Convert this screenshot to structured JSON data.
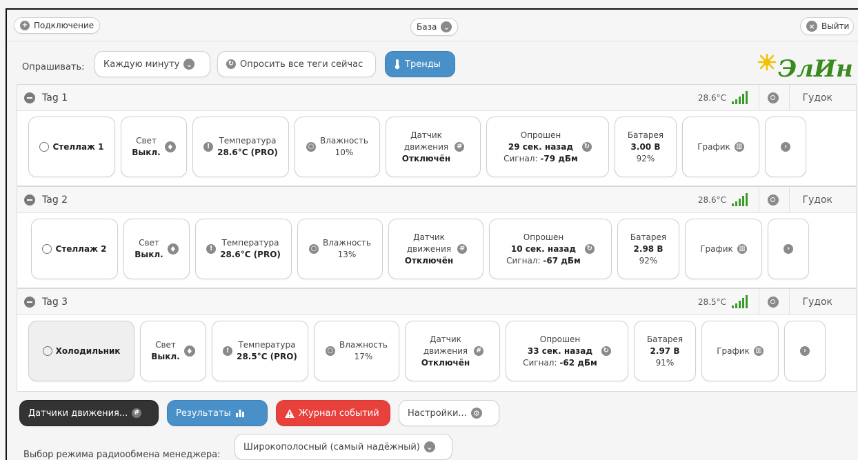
{
  "header": {
    "connect_label": "Подключение",
    "base_label": "База",
    "exit_label": "Выйти"
  },
  "poll": {
    "label": "Опрашивать:",
    "interval": "Каждую минуту",
    "poll_all_label": "Опросить все теги сейчас",
    "trends_label": "Тренды"
  },
  "logo": {
    "text": "ЭлИн"
  },
  "tags": [
    {
      "name": "Tag 1",
      "head_temp": "28.6°C",
      "beep": "Гудок",
      "location": "Стеллаж 1",
      "light_label": "Свет",
      "light_value": "Выкл.",
      "temp_label": "Температура",
      "temp_value": "28.6°C (PRO)",
      "humidity_label": "Влажность",
      "humidity_value": "10%",
      "motion_label_1": "Датчик",
      "motion_label_2": "движения",
      "motion_value": "Отключён",
      "polled_label": "Опрошен",
      "polled_value": "29 сек. назад",
      "signal_label": "Сигнал:",
      "signal_value": "-79 дБм",
      "battery_label": "Батарея",
      "battery_voltage": "3.00 В",
      "battery_percent": "92%",
      "graph_label": "График"
    },
    {
      "name": "Tag 2",
      "head_temp": "28.6°C",
      "beep": "Гудок",
      "location": "Стеллаж 2",
      "light_label": "Свет",
      "light_value": "Выкл.",
      "temp_label": "Температура",
      "temp_value": "28.6°C (PRO)",
      "humidity_label": "Влажность",
      "humidity_value": "13%",
      "motion_label_1": "Датчик",
      "motion_label_2": "движения",
      "motion_value": "Отключён",
      "polled_label": "Опрошен",
      "polled_value": "10 сек. назад",
      "signal_label": "Сигнал:",
      "signal_value": "-67 дБм",
      "battery_label": "Батарея",
      "battery_voltage": "2.98 В",
      "battery_percent": "92%",
      "graph_label": "График"
    },
    {
      "name": "Tag 3",
      "head_temp": "28.5°C",
      "beep": "Гудок",
      "location": "Холодильник",
      "light_label": "Свет",
      "light_value": "Выкл.",
      "temp_label": "Температура",
      "temp_value": "28.5°C (PRO)",
      "humidity_label": "Влажность",
      "humidity_value": "17%",
      "motion_label_1": "Датчик",
      "motion_label_2": "движения",
      "motion_value": "Отключён",
      "polled_label": "Опрошен",
      "polled_value": "33 сек. назад",
      "signal_label": "Сигнал:",
      "signal_value": "-62 дБм",
      "battery_label": "Батарея",
      "battery_voltage": "2.97 В",
      "battery_percent": "91%",
      "graph_label": "График"
    }
  ],
  "bottom": {
    "motion_sensors_label": "Датчики движения...",
    "results_label": "Результаты",
    "event_log_label": "Журнал событий",
    "settings_label": "Настройки...",
    "radio_mode_label": "Выбор режима радиообмена менеджера:",
    "radio_mode_value": "Широкополосный (самый надёжный)"
  },
  "colors": {
    "blue": "#4a90c8",
    "dark": "#333333",
    "red": "#e8413c",
    "signal_green": "#3a9a2a",
    "logo_yellow": "#f2c200",
    "logo_green": "#3a8a1e"
  }
}
